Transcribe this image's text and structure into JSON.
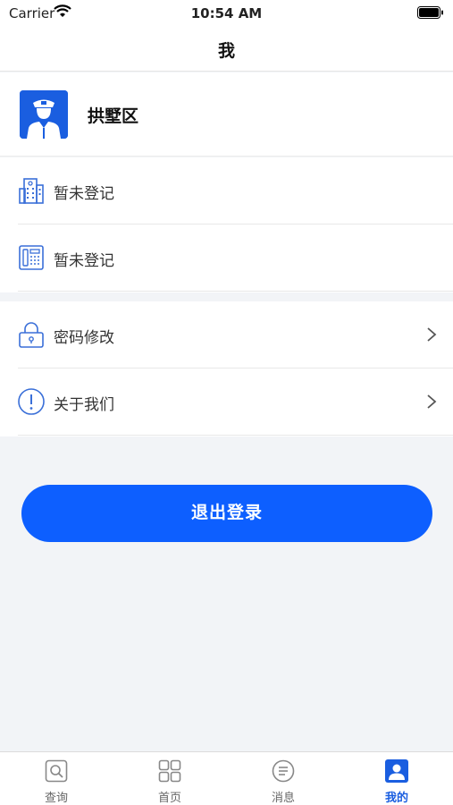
{
  "status_bar": {
    "carrier": "Carrier",
    "time": "10:54 AM"
  },
  "nav": {
    "title": "我"
  },
  "profile": {
    "name": "拱墅区",
    "avatar_icon": "police-officer-icon"
  },
  "info_rows": [
    {
      "label": "暂未登记",
      "icon": "building-icon"
    },
    {
      "label": "暂未登记",
      "icon": "telephone-icon"
    }
  ],
  "menu_rows": [
    {
      "label": "密码修改",
      "icon": "lock-icon"
    },
    {
      "label": "关于我们",
      "icon": "info-icon"
    }
  ],
  "logout_label": "退出登录",
  "tabs": [
    {
      "label": "查询",
      "icon": "search-icon"
    },
    {
      "label": "首页",
      "icon": "grid-icon"
    },
    {
      "label": "消息",
      "icon": "message-icon"
    },
    {
      "label": "我的",
      "icon": "user-icon"
    }
  ],
  "colors": {
    "accent": "#0d5fff",
    "active_tab": "#1a5ee0",
    "background": "#f2f4f7"
  }
}
